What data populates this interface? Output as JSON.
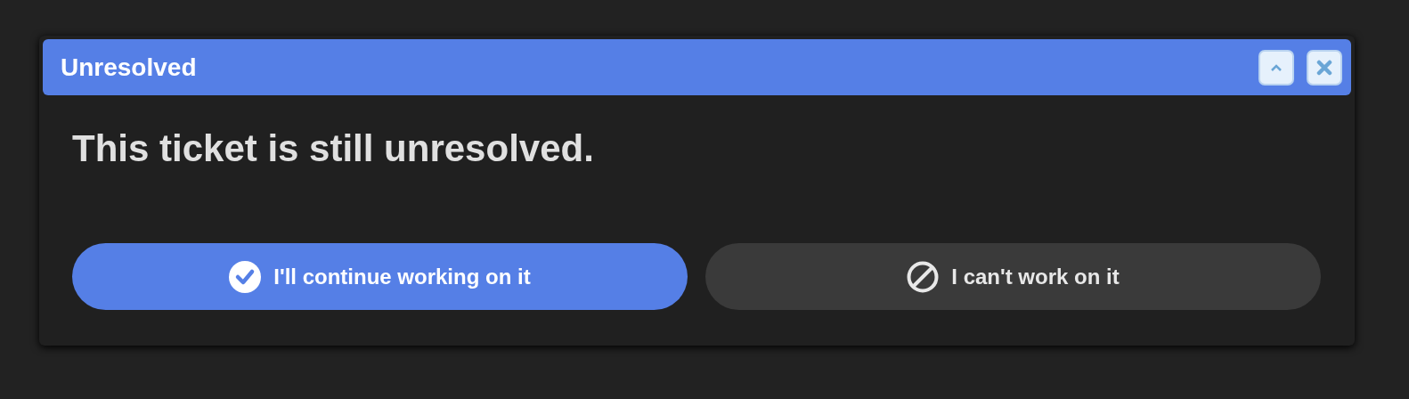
{
  "dialog": {
    "title": "Unresolved",
    "message": "This ticket is still unresolved.",
    "buttons": [
      {
        "label": "I'll continue working on it",
        "kind": "confirm"
      },
      {
        "label": "I can't work on it",
        "kind": "decline"
      }
    ]
  }
}
